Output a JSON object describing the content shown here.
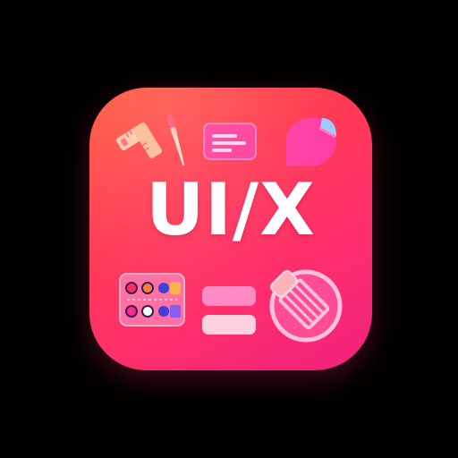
{
  "app_icon": {
    "wordmark": "UI/X",
    "palette": {
      "gradient_start": "#ff5a3c",
      "gradient_mid": "#ff3b54",
      "gradient_end": "#f0217e",
      "wordmark_color": "#ffffff",
      "glyph_light": "#ffc7a8",
      "glyph_pink": "#ff3fa4",
      "glyph_pale_pink": "#ffd0de",
      "glyph_blue": "#6fb7ff"
    },
    "glyphs": [
      "ruler-square-icon",
      "paintbrush-icon",
      "text-card-icon",
      "speech-bubble-icon",
      "color-palette-grid-icon",
      "stacked-bars-icon",
      "pencil-eraser-icon"
    ]
  }
}
